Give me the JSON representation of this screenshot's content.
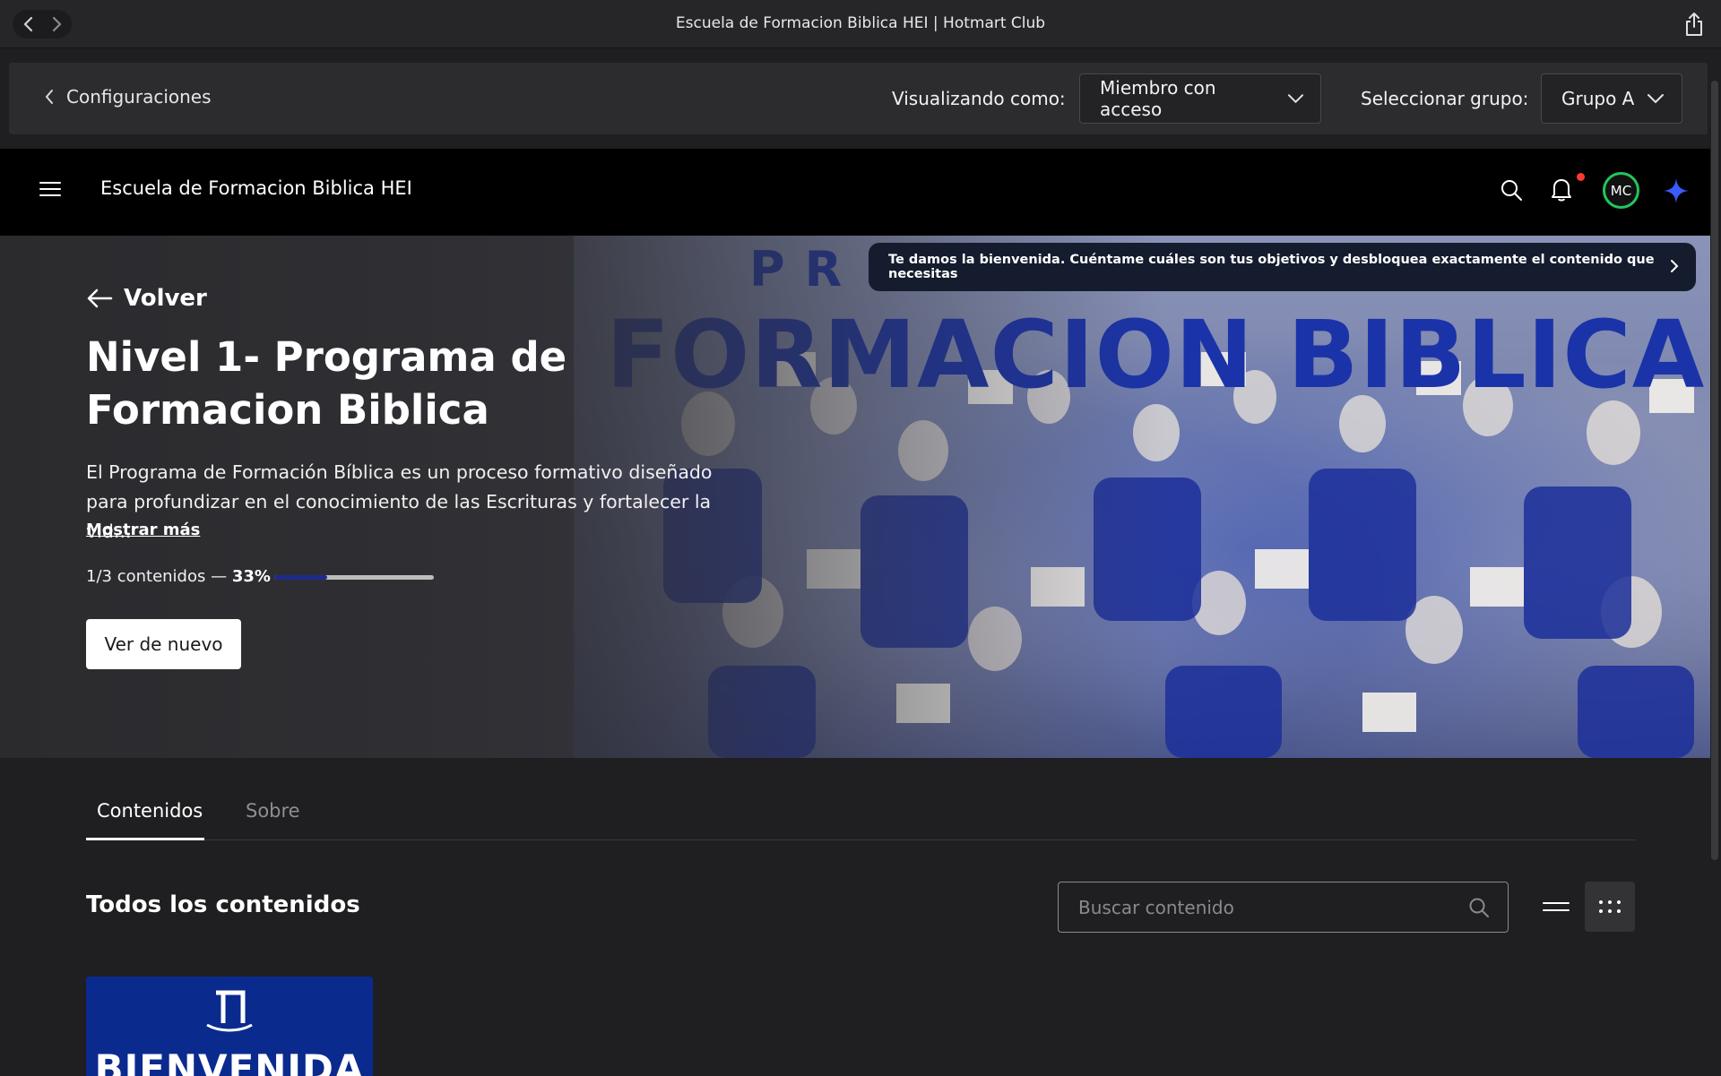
{
  "browser": {
    "title": "Escuela de Formacion Biblica HEI | Hotmart Club"
  },
  "config_bar": {
    "back_label": "Configuraciones",
    "viewing_as_label": "Visualizando como:",
    "viewing_as_value": "Miembro con acceso",
    "group_label": "Seleccionar grupo:",
    "group_value": "Grupo A"
  },
  "header": {
    "club_title": "Escuela de Formacion Biblica HEI",
    "avatar_initials": "MC",
    "colors": {
      "avatar_ring": "#22c55e",
      "notification_dot": "#ff3b30",
      "sparkle": "#3b5bff"
    }
  },
  "hero": {
    "banner_heading": "FORMACION BIBLICA",
    "banner_prefix": "PR",
    "welcome_message": "Te damos la bienvenida. Cuéntame cuáles son tus objetivos y desbloquea exactamente el contenido que necesitas",
    "back_label": "Volver",
    "course_title": "Nivel 1- Programa de Formacion Biblica",
    "description_line1": "El Programa de Formación Bíblica es un proceso formativo diseñado",
    "description_line2": "para profundizar en el conocimiento de las Escrituras y fortalecer la vid...",
    "show_more": "Mostrar más",
    "progress_count": "1/3 contenidos —",
    "progress_percent_label": "33%",
    "progress_value": 33,
    "rewatch_button": "Ver de nuevo"
  },
  "tabs": [
    {
      "label": "Contenidos",
      "active": true
    },
    {
      "label": "Sobre",
      "active": false
    }
  ],
  "contents": {
    "section_title": "Todos los contenidos",
    "search_placeholder": "Buscar contenido",
    "cards": [
      {
        "label": "BIENVENIDA"
      }
    ]
  }
}
